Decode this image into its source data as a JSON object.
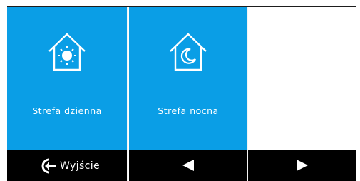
{
  "tiles": [
    {
      "label": "Strefa dzienna",
      "icon": "house-sun-icon"
    },
    {
      "label": "Strefa nocna",
      "icon": "house-moon-icon"
    }
  ],
  "bottom_bar": {
    "exit_label": "Wyjście",
    "exit_icon": "exit-arrow-icon",
    "prev_icon": "triangle-left-icon",
    "next_icon": "triangle-right-icon"
  },
  "colors": {
    "tile": "#0a9ee6",
    "bar": "#000000",
    "text": "#ffffff"
  }
}
